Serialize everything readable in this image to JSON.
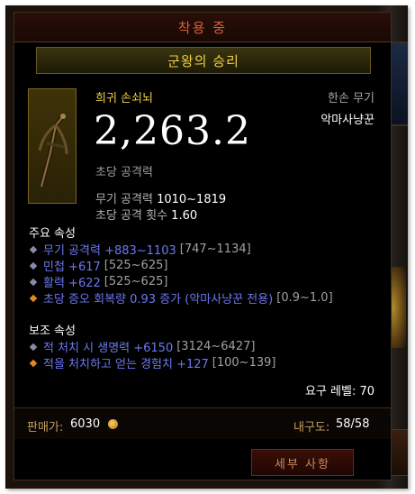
{
  "header": {
    "title": "착용 중"
  },
  "item": {
    "name": "군왕의 승리",
    "rarity": "희귀 손쇠뇌",
    "slot": "한손 무기",
    "weapon_type": "악마사냥꾼",
    "dps": "2,263.2",
    "dps_label": "초당 공격력",
    "damage_label": "무기 공격력",
    "damage_value": "1010~1819",
    "aps_label": "초당 공격 횟수",
    "aps_value": "1.60",
    "icon": "hand-crossbow-icon"
  },
  "primary": {
    "heading": "주요 속성",
    "props": [
      {
        "text": "무기 공격력 +883~1103",
        "range": "[747~1134]",
        "bullet_color": "#8a8aa8"
      },
      {
        "text": "민첩 +617",
        "range": "[525~625]",
        "bullet_color": "#8a8aa8"
      },
      {
        "text": "활력 +622",
        "range": "[525~625]",
        "bullet_color": "#8a8aa8"
      },
      {
        "text": "초당 증오 회복량 0.93 증가 (악마사냥꾼 전용)",
        "range": "[0.9~1.0]",
        "bullet_color": "#e08a20"
      }
    ]
  },
  "secondary": {
    "heading": "보조 속성",
    "props": [
      {
        "text": "적 처치 시 생명력 +6150",
        "range": "[3124~6427]",
        "bullet_color": "#8a8aa8"
      },
      {
        "text": "적을 처치하고 얻는 경험치 +127",
        "range": "[100~139]",
        "bullet_color": "#e08a20"
      }
    ]
  },
  "requirement": "요구 레벨: 70",
  "footer": {
    "price_label": "판매가:",
    "price_value": "6030",
    "durability_label": "내구도:",
    "durability_value": "58/58"
  },
  "details_button": "세부 사항",
  "colors": {
    "title": "#d4603a",
    "item_name": "#f0d040",
    "affix": "#6c78f0"
  }
}
